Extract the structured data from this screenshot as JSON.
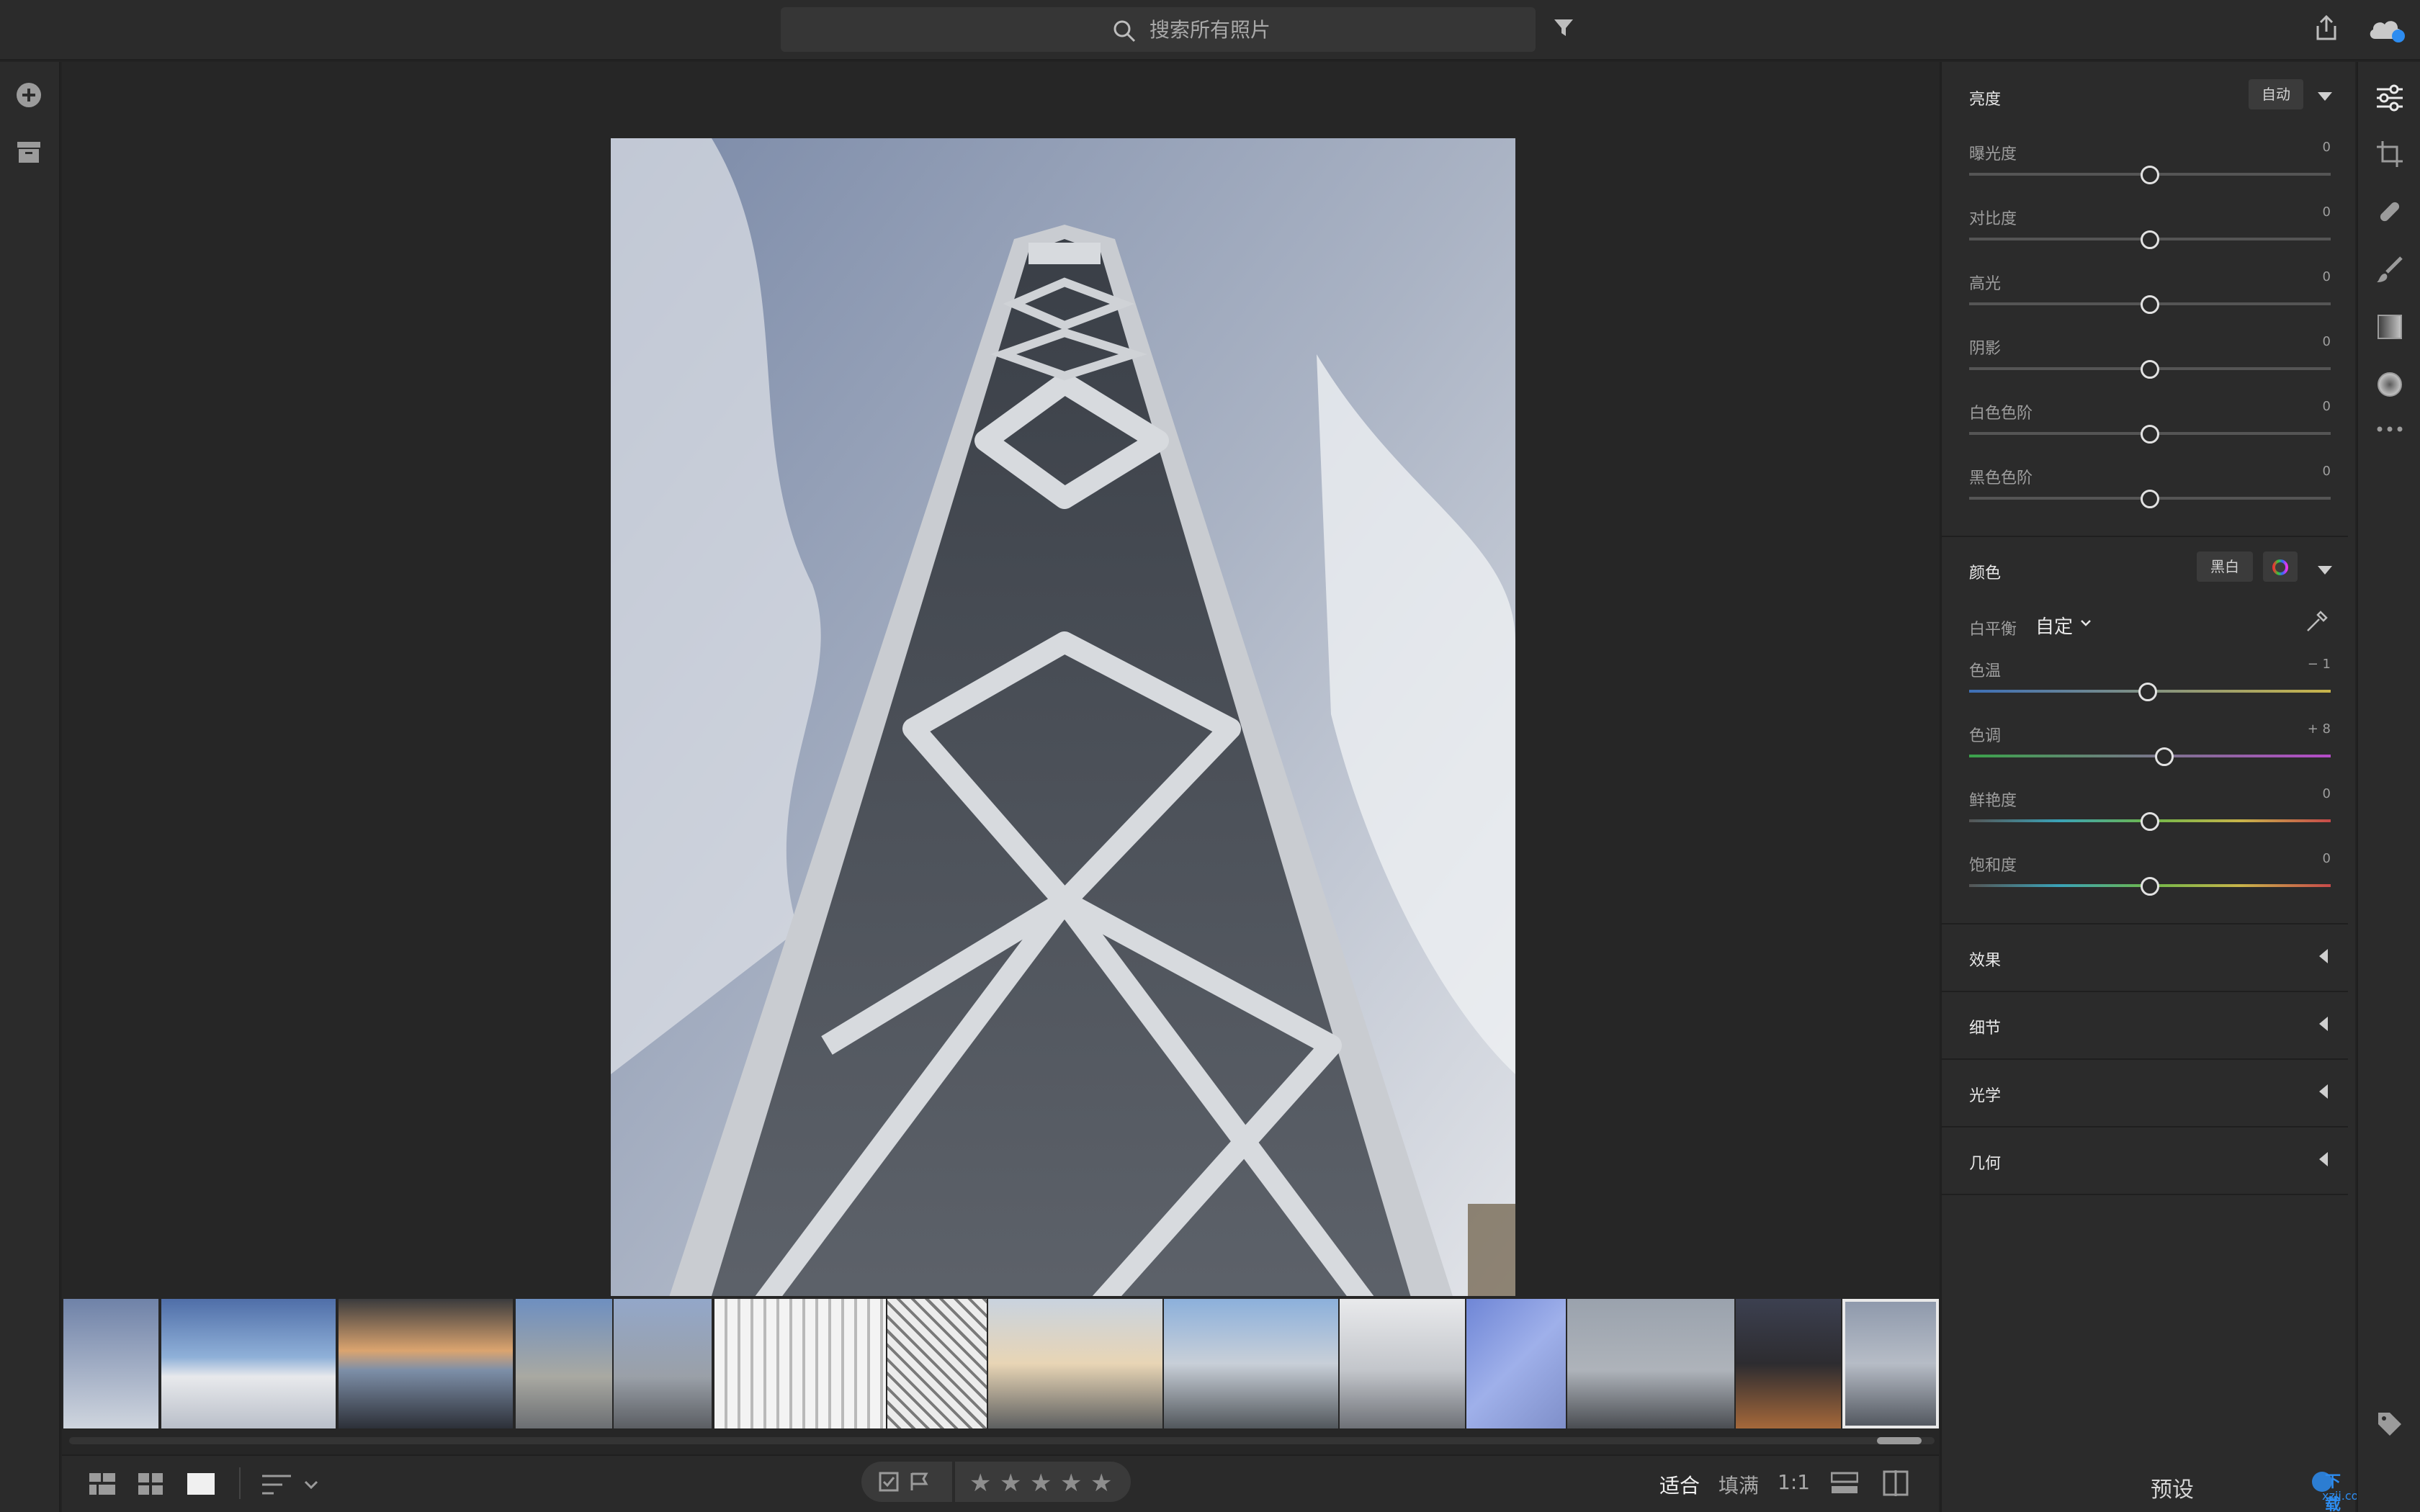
{
  "search": {
    "placeholder": "搜索所有照片"
  },
  "edit_panel": {
    "light": {
      "title": "亮度",
      "auto_button": "自动",
      "sliders": [
        {
          "label": "曝光度",
          "value": "0",
          "position": 0.5
        },
        {
          "label": "对比度",
          "value": "0",
          "position": 0.5
        },
        {
          "label": "高光",
          "value": "0",
          "position": 0.5
        },
        {
          "label": "阴影",
          "value": "0",
          "position": 0.5
        },
        {
          "label": "白色色阶",
          "value": "0",
          "position": 0.5
        },
        {
          "label": "黑色色阶",
          "value": "0",
          "position": 0.5
        }
      ]
    },
    "color": {
      "title": "颜色",
      "bw_button": "黑白",
      "white_balance_label": "白平衡",
      "white_balance_value": "自定",
      "sliders": [
        {
          "label": "色温",
          "value": "− 1",
          "position": 0.495,
          "track": "temp"
        },
        {
          "label": "色调",
          "value": "+ 8",
          "position": 0.54,
          "track": "tint"
        },
        {
          "label": "鲜艳度",
          "value": "0",
          "position": 0.5,
          "track": "sat"
        },
        {
          "label": "饱和度",
          "value": "0",
          "position": 0.5,
          "track": "sat"
        }
      ]
    },
    "collapsed_sections": [
      "效果",
      "细节",
      "光学",
      "几何"
    ]
  },
  "bottom_bar": {
    "zoom_options": {
      "fit": "适合",
      "fill": "填满",
      "one_to_one": "1:1"
    },
    "rating_stars": 5,
    "presets_label": "预设"
  },
  "watermark": {
    "text": "下载集",
    "url_text": "xzji.com"
  },
  "colors": {
    "accent": "#2d8cf0",
    "panel_bg": "#2b2b2b",
    "viewer_bg": "#262626"
  }
}
